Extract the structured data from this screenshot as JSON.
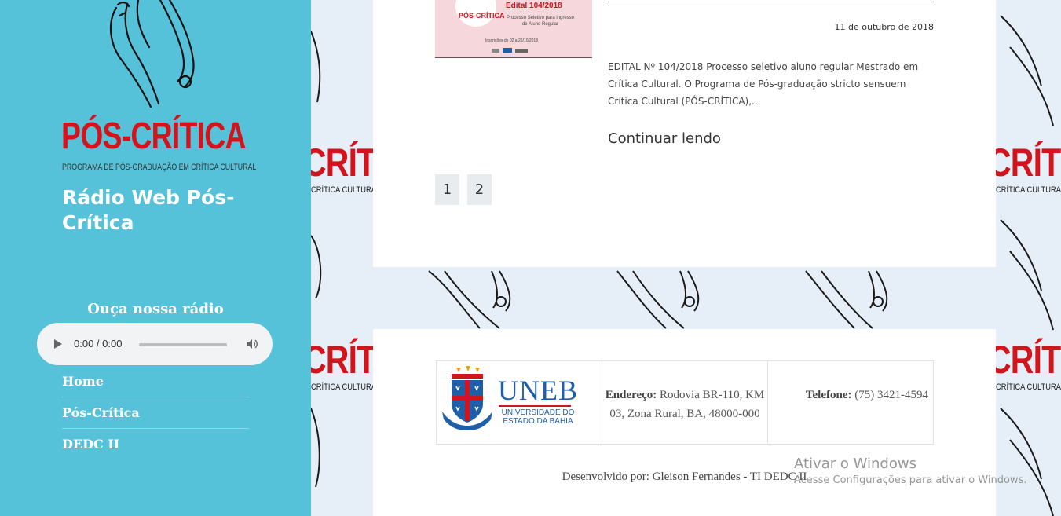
{
  "sidebar": {
    "logo": {
      "brand": "PÓS-CRÍTICA",
      "subtitle": "PROGRAMA DE PÓS-GRADUAÇÃO EM CRÍTICA CULTURAL"
    },
    "site_title": "Rádio Web Pós-Crítica",
    "radio_heading": "Ouça nossa rádio",
    "audio": {
      "time": "0:00 / 0:00"
    },
    "nav": [
      {
        "label": "Home"
      },
      {
        "label": "Pós-Crítica"
      },
      {
        "label": "DEDC II"
      }
    ]
  },
  "background": {
    "word": "CRÍTICA",
    "sub": "CRÍTICA CULTURAL"
  },
  "post": {
    "thumbnail": {
      "brand": "PÓS-CRÍTICA",
      "title": "Edital 104/2018",
      "desc": "Processo Seletivo para ingresso de Aluno Regular",
      "dates": "Inscrições de 02 a 26/10/2018"
    },
    "date": "11 de outubro de 2018",
    "excerpt": "EDITAL Nº 104/2018 Processo seletivo aluno regular Mestrado em Crítica Cultural. O Programa de Pós-graduação stricto sensuem Crítica Cultural (PÓS-CRÍTICA),...",
    "read_more": "Continuar lendo"
  },
  "pagination": [
    "1",
    "2"
  ],
  "footer": {
    "uneb": {
      "name": "UNEB",
      "line1": "UNIVERSIDADE DO",
      "line2": "ESTADO DA BAHIA"
    },
    "address_label": "Endereço:",
    "address_value": "Rodovia BR-110, KM 03, Zona Rural, BA, 48000-000",
    "phone_label": "Telefone:",
    "phone_value": "(75) 3421-4594",
    "credits": "Desenvolvido por: Gleison Fernandes - TI DEDC II"
  },
  "watermark": {
    "title": "Ativar o Windows",
    "subtitle": "Acesse Configurações para ativar o Windows."
  },
  "colors": {
    "sidebar": "#56c2da",
    "brand_red": "#d3141c",
    "uneb_blue": "#1f5ea8"
  }
}
